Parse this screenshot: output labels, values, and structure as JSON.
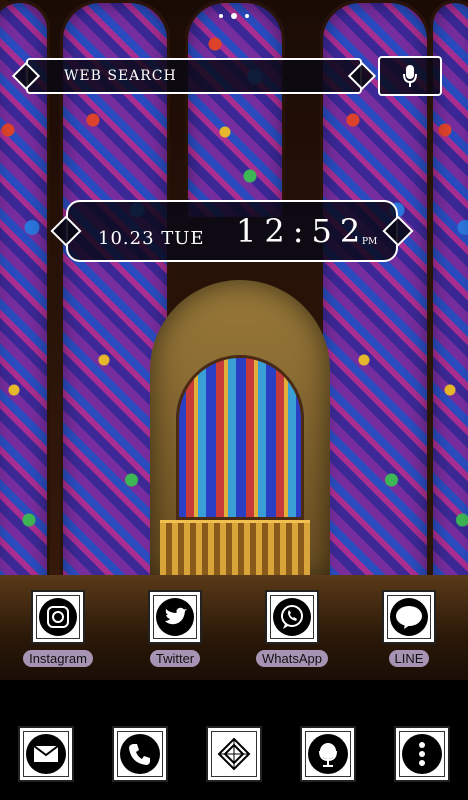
{
  "home": {
    "page_indicator_count": 3,
    "page_indicator_active": 2
  },
  "search": {
    "label": "WEB SEARCH",
    "voice_icon": "microphone-icon"
  },
  "clock": {
    "date": "10.23 TUE",
    "time": "12:52",
    "ampm": "PM"
  },
  "apps": [
    {
      "label": "Instagram",
      "icon": "camera-icon"
    },
    {
      "label": "Twitter",
      "icon": "bird-icon"
    },
    {
      "label": "WhatsApp",
      "icon": "phone-bubble-icon"
    },
    {
      "label": "LINE",
      "icon": "line-bubble-icon"
    }
  ],
  "dock": [
    {
      "icon": "mail-icon"
    },
    {
      "icon": "phone-icon"
    },
    {
      "icon": "app-drawer-icon"
    },
    {
      "icon": "globe-icon"
    },
    {
      "icon": "menu-icon"
    }
  ]
}
